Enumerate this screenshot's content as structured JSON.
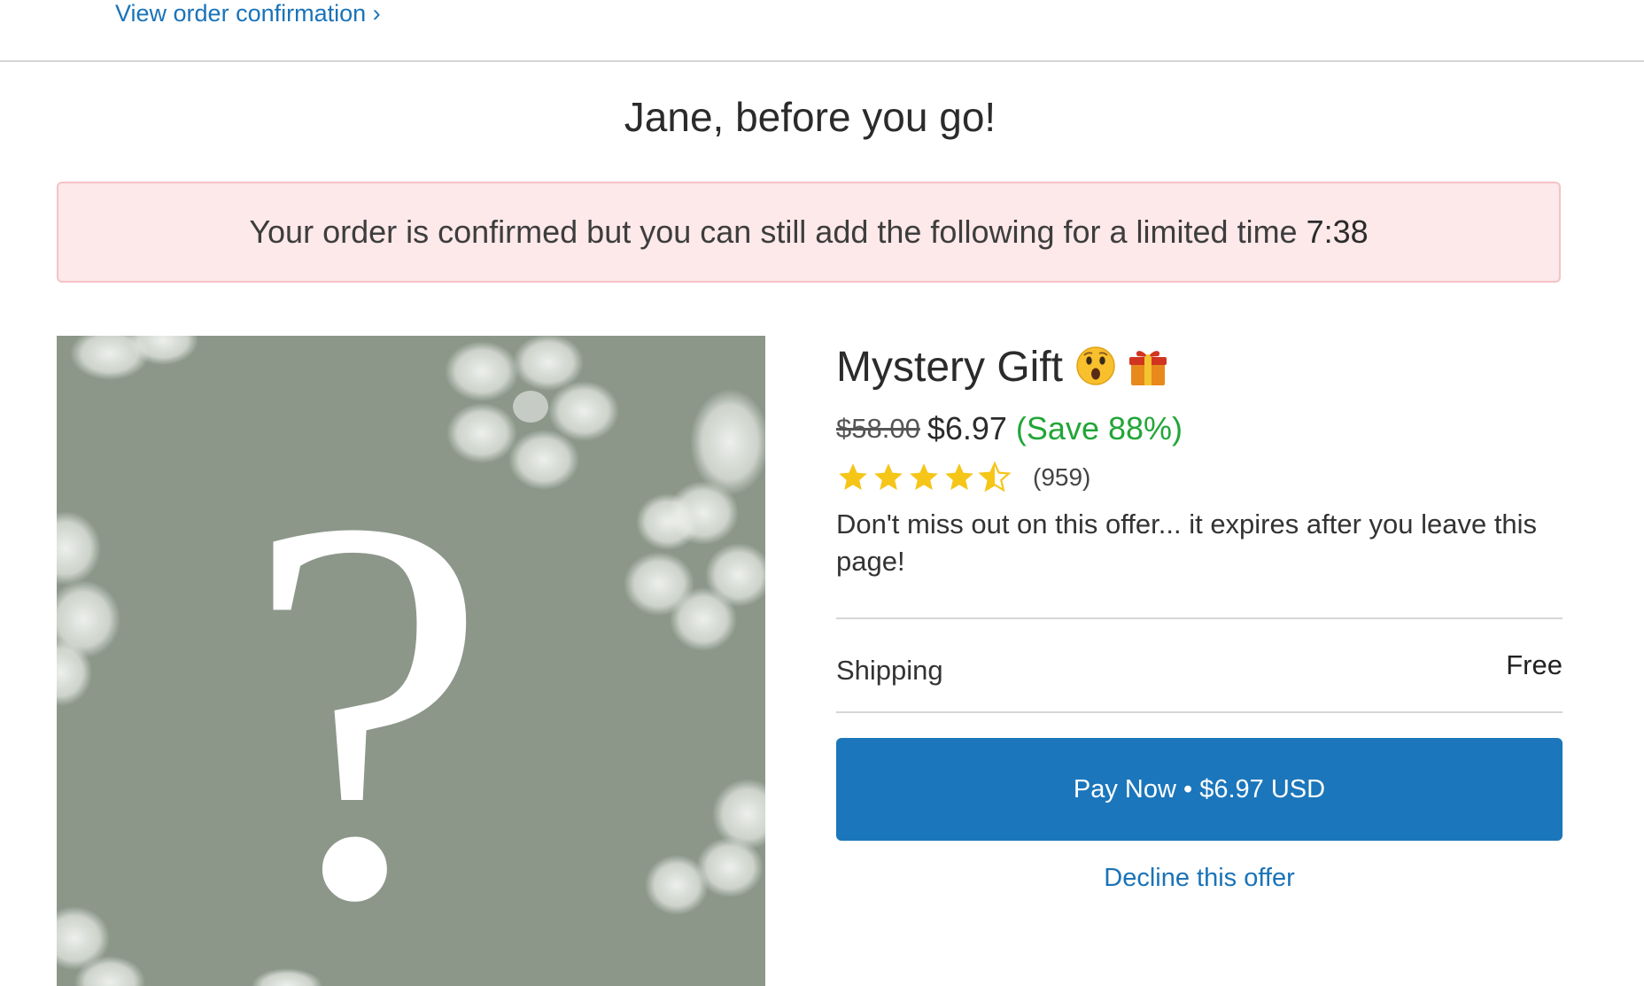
{
  "header": {
    "view_order_link": "View order confirmation ›"
  },
  "headline": "Jane, before you go!",
  "alert": {
    "message": "Your order is confirmed but you can still add the following for a limited time",
    "timer": "7:38"
  },
  "product": {
    "title": "Mystery Gift",
    "emojis": [
      "astonished-face-emoji",
      "wrapped-gift-emoji"
    ],
    "price_old": "$58.00",
    "price_new": "$6.97",
    "price_save": "(Save 88%)",
    "rating": 4.5,
    "rating_max": 5,
    "rating_count": "(959)",
    "offer_text": "Don't miss out on this offer... it expires after you leave this page!",
    "image_symbol": "?",
    "image_bg_color": "#8c978a"
  },
  "shipping": {
    "label": "Shipping",
    "value": "Free"
  },
  "actions": {
    "pay_label": "Pay Now • $6.97 USD",
    "decline_label": "Decline this offer"
  },
  "colors": {
    "link": "#1a73b8",
    "button": "#1b76bb",
    "save": "#21a637",
    "alert_bg": "#fde8ea",
    "alert_border": "#f5c2c7",
    "star": "#f5c518"
  }
}
